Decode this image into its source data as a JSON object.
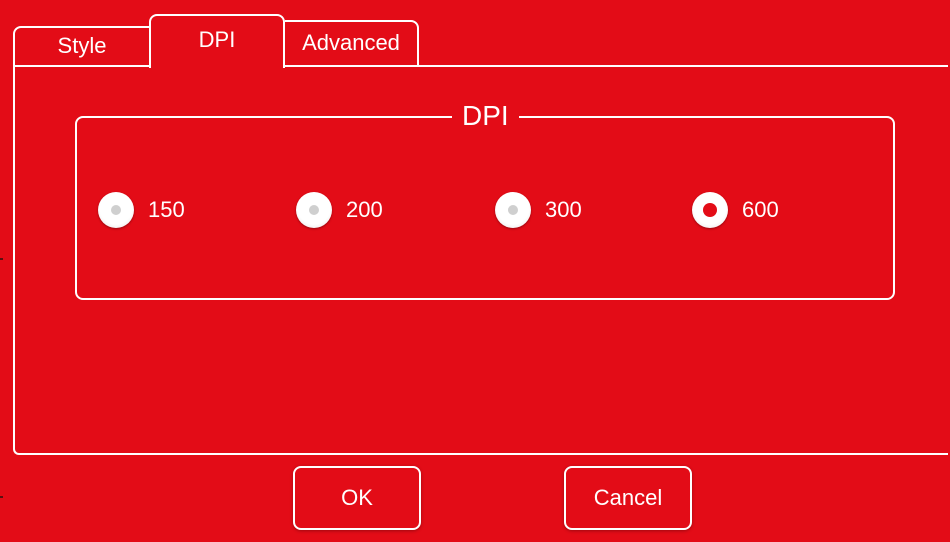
{
  "tabs": [
    {
      "label": "Style",
      "active": false
    },
    {
      "label": "DPI",
      "active": true
    },
    {
      "label": "Advanced",
      "active": false
    }
  ],
  "group": {
    "title": "DPI"
  },
  "dpi_options": [
    {
      "label": "150",
      "checked": false
    },
    {
      "label": "200",
      "checked": false
    },
    {
      "label": "300",
      "checked": false
    },
    {
      "label": "600",
      "checked": true
    }
  ],
  "buttons": {
    "ok_label": "OK",
    "cancel_label": "Cancel"
  },
  "colors": {
    "background": "#e30c17",
    "foreground": "#ffffff"
  }
}
